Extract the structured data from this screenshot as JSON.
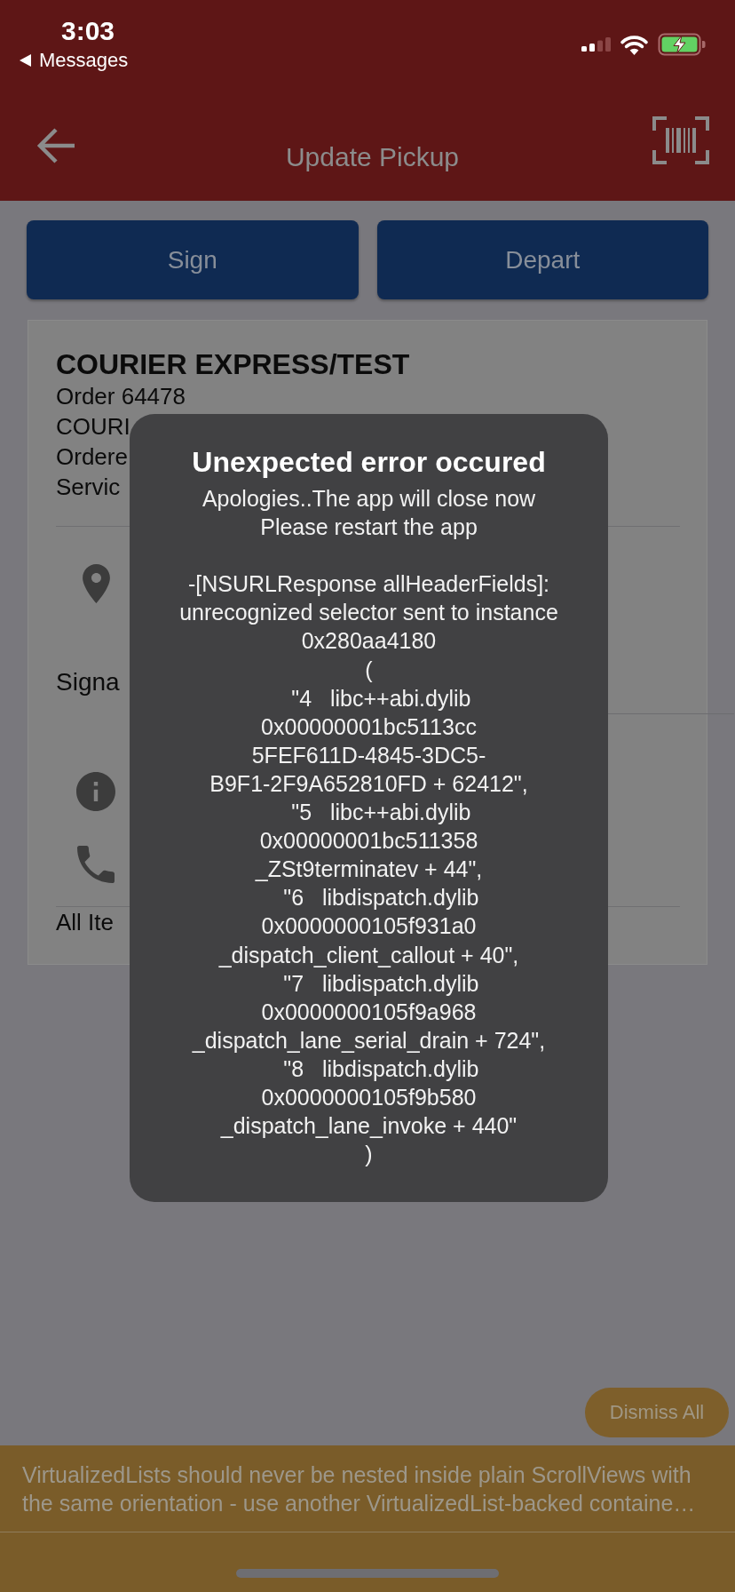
{
  "status_bar": {
    "time": "3:03",
    "back_label": "Messages"
  },
  "header": {
    "title": "Update Pickup"
  },
  "action_buttons": [
    {
      "label": "Sign"
    },
    {
      "label": "Depart"
    }
  ],
  "order_card": {
    "title": "COURIER EXPRESS/TEST",
    "lines": [
      "Order 64478",
      "COURI",
      "Ordere",
      "Servic"
    ],
    "section_label": "Signa",
    "footer_label": "All Ite"
  },
  "error_dialog": {
    "title": "Unexpected error occured",
    "message": "Apologies..The app will close now\nPlease restart the app\n\n-[NSURLResponse allHeaderFields]:\nunrecognized selector sent to instance\n0x280aa4180\n(\n    \"4   libc++abi.dylib\n0x00000001bc5113cc\n5FEF611D-4845-3DC5-\nB9F1-2F9A652810FD + 62412\",\n    \"5   libc++abi.dylib\n0x00000001bc511358\n_ZSt9terminatev + 44\",\n    \"6   libdispatch.dylib\n0x0000000105f931a0\n_dispatch_client_callout + 40\",\n    \"7   libdispatch.dylib\n0x0000000105f9a968\n_dispatch_lane_serial_drain + 724\",\n    \"8   libdispatch.dylib\n0x0000000105f9b580\n_dispatch_lane_invoke + 440\"\n)"
  },
  "dismiss_button": {
    "label": "Dismiss All"
  },
  "warning_banner": {
    "message": "VirtualizedLists should never be nested inside plain ScrollViews with\nthe same orientation - use another VirtualizedList-backed containe…"
  }
}
